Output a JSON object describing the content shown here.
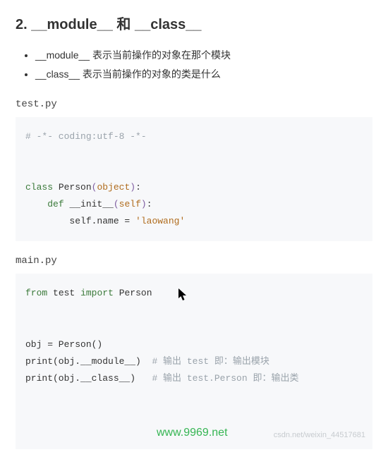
{
  "heading": "2. __module__ 和 __class__",
  "bullets": [
    "__module__ 表示当前操作的对象在那个模块",
    "__class__ 表示当前操作的对象的类是什么"
  ],
  "file1": {
    "name": "test.py",
    "lines": {
      "l1_comment": "# -*- coding:utf-8 -*-",
      "l2_class": "class",
      "l2_name": "Person",
      "l2_base": "object",
      "l3_def": "def",
      "l3_fn": "__init__",
      "l3_arg": "self",
      "l4_body_pre": "self.name = ",
      "l4_str": "'laowang'"
    }
  },
  "file2": {
    "name": "main.py",
    "lines": {
      "l1_from": "from",
      "l1_mod": "test",
      "l1_import": "import",
      "l1_name": "Person",
      "l3": "obj = Person()",
      "l4_code": "print(obj.__module__)",
      "l4_comment": "# 输出 test 即：输出模块",
      "l5_code": "print(obj.__class__)",
      "l5_comment": "# 输出 test.Person 即：输出类"
    }
  },
  "watermark_green": "www.9969.net",
  "watermark_grey": "csdn.net/weixin_44517681"
}
